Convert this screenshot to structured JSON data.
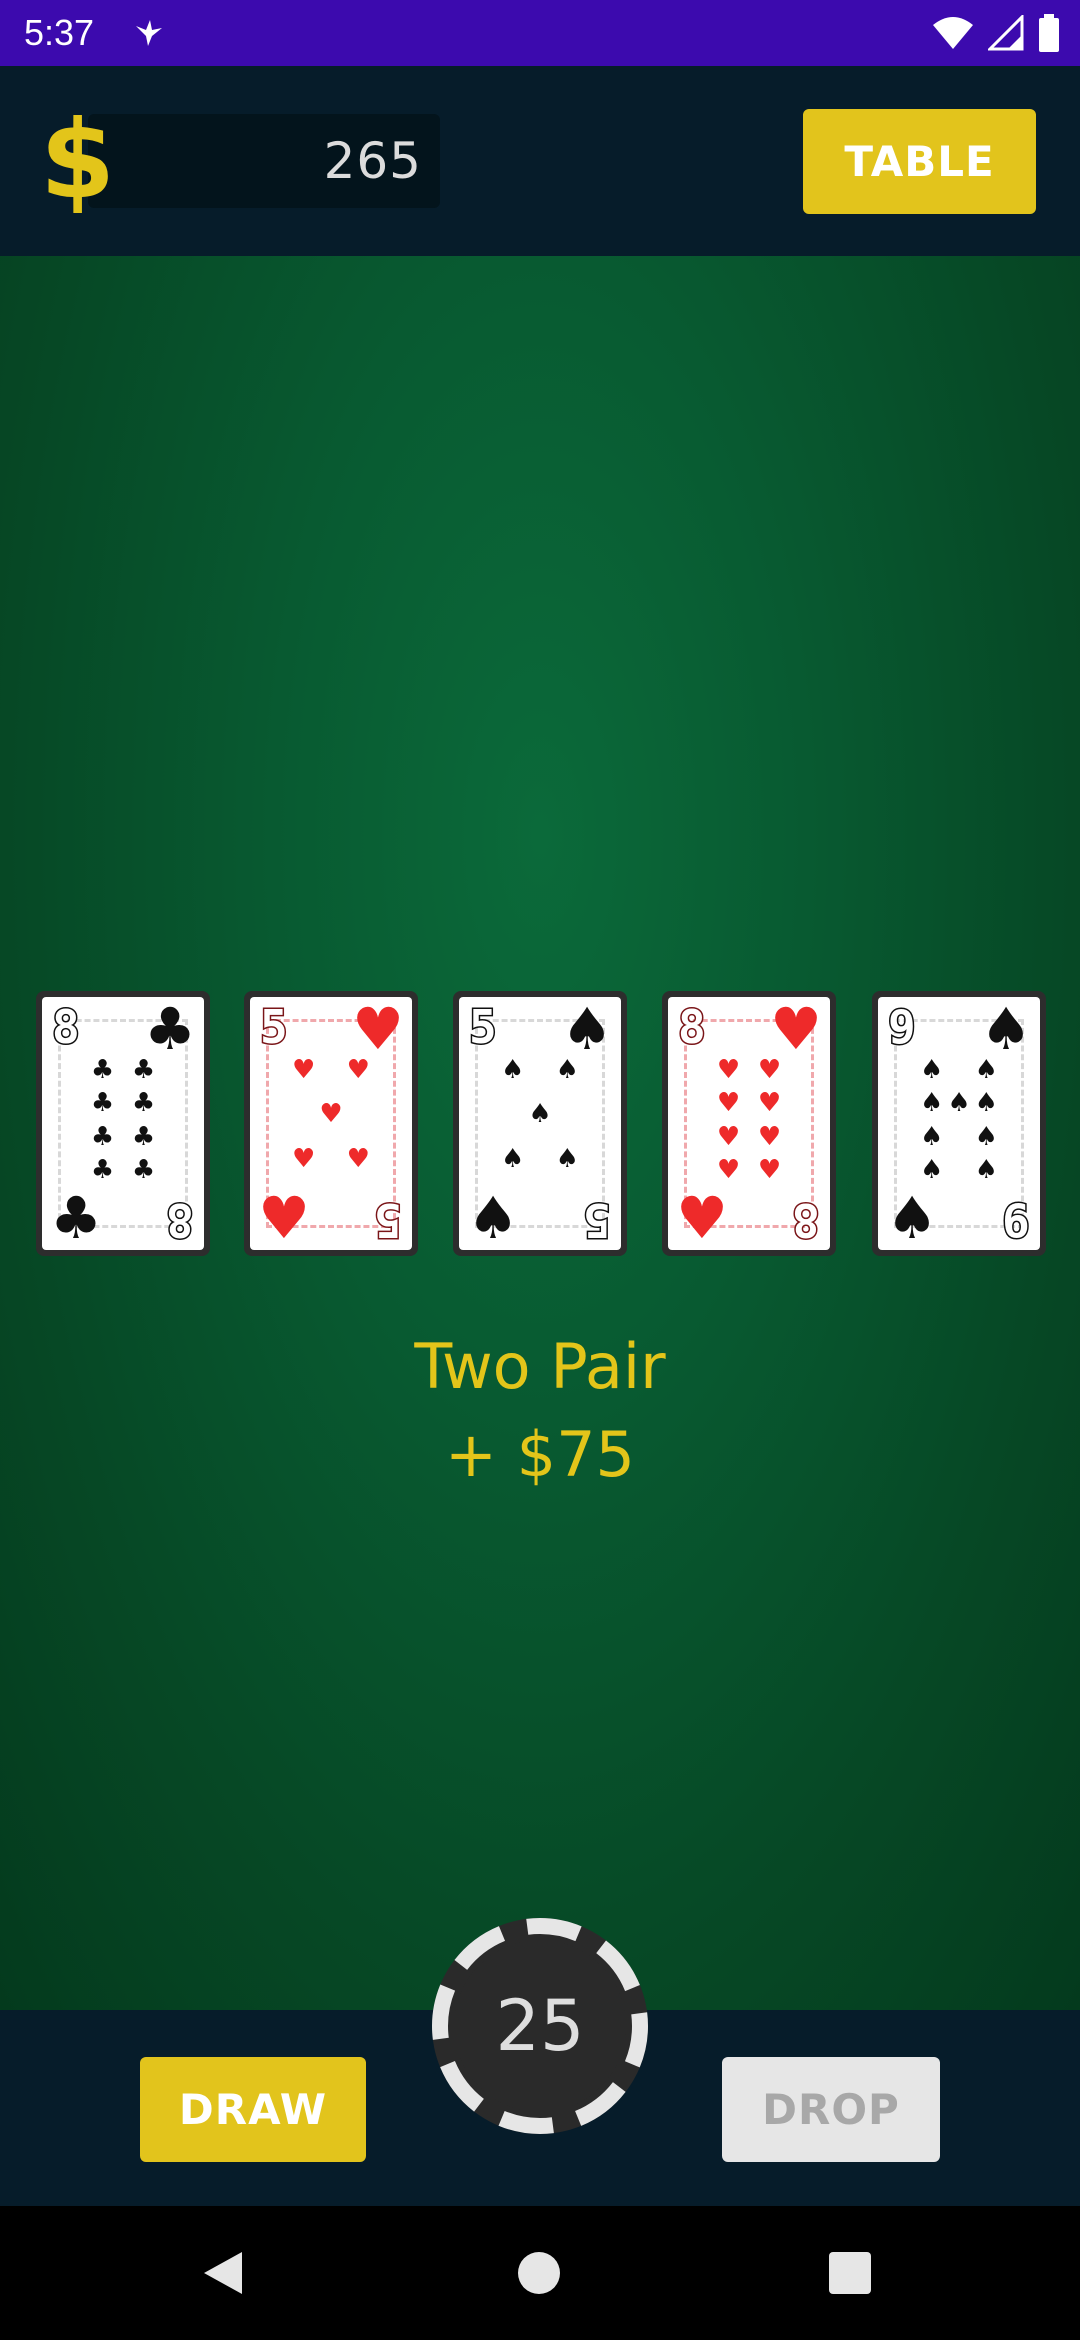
{
  "status_bar": {
    "time": "5:37",
    "icons": [
      "app-notification-icon",
      "wifi-icon",
      "signal-icon",
      "battery-icon"
    ]
  },
  "header": {
    "currency_symbol": "$",
    "balance": "265",
    "table_button": "TABLE"
  },
  "hand": {
    "cards": [
      {
        "rank": "8",
        "suit": "♣",
        "suit_name": "clubs",
        "color": "black"
      },
      {
        "rank": "5",
        "suit": "♥",
        "suit_name": "hearts",
        "color": "red"
      },
      {
        "rank": "5",
        "suit": "♠",
        "suit_name": "spades",
        "color": "black"
      },
      {
        "rank": "8",
        "suit": "♥",
        "suit_name": "hearts",
        "color": "red"
      },
      {
        "rank": "9",
        "suit": "♠",
        "suit_name": "spades",
        "color": "black"
      }
    ]
  },
  "result": {
    "hand_name": "Two Pair",
    "payout": "+ $75"
  },
  "controls": {
    "draw_button": "DRAW",
    "drop_button": "DROP",
    "bet_chip": "25"
  },
  "colors": {
    "status_bar": "#3c0aae",
    "panel": "#061c2a",
    "accent_yellow": "#e2c41c",
    "felt_green": "#085a31",
    "card_red": "#ee2a2a"
  }
}
